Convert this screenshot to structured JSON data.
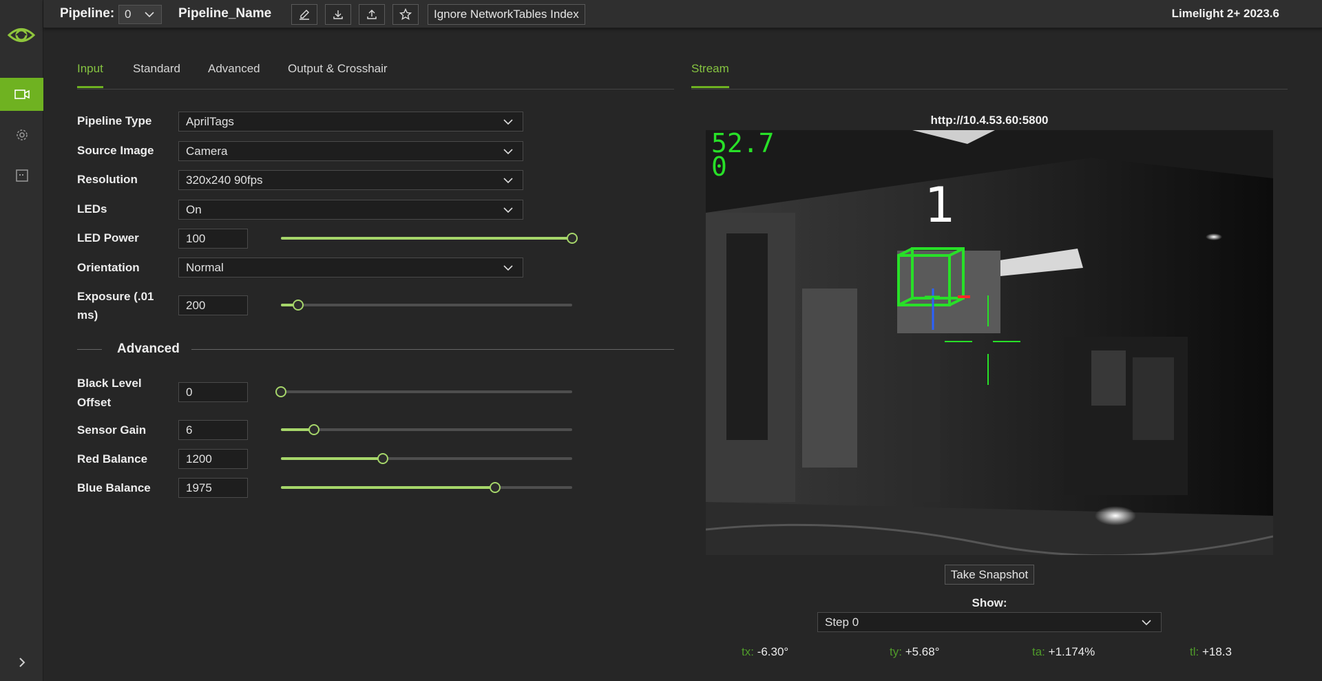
{
  "topbar": {
    "pipeline_label": "Pipeline:",
    "pipeline_value": "0",
    "pipeline_name": "Pipeline_Name",
    "ignore_label": "Ignore NetworkTables Index",
    "brand": "Limelight 2+ 2023.6"
  },
  "left_tabs": [
    {
      "label": "Input",
      "active": true
    },
    {
      "label": "Standard",
      "active": false
    },
    {
      "label": "Advanced",
      "active": false
    },
    {
      "label": "Output & Crosshair",
      "active": false
    }
  ],
  "right_tabs": [
    {
      "label": "Stream",
      "active": true
    }
  ],
  "form": {
    "pipeline_type": {
      "label": "Pipeline Type",
      "value": "AprilTags"
    },
    "source_image": {
      "label": "Source Image",
      "value": "Camera"
    },
    "resolution": {
      "label": "Resolution",
      "value": "320x240 90fps"
    },
    "leds": {
      "label": "LEDs",
      "value": "On"
    },
    "led_power": {
      "label": "LED Power",
      "value": "100",
      "slider_fraction": 1.0
    },
    "orientation": {
      "label": "Orientation",
      "value": "Normal"
    },
    "exposure": {
      "label_line1": "Exposure (.01",
      "label_line2": "ms)",
      "value": "200",
      "slider_fraction": 0.06
    }
  },
  "advanced": {
    "title": "Advanced",
    "black_level": {
      "label_line1": "Black Level",
      "label_line2": "Offset",
      "value": "0",
      "slider_fraction": 0.0
    },
    "sensor_gain": {
      "label": "Sensor Gain",
      "value": "6",
      "slider_fraction": 0.114
    },
    "red_balance": {
      "label": "Red Balance",
      "value": "1200",
      "slider_fraction": 0.35
    },
    "blue_balance": {
      "label": "Blue Balance",
      "value": "1975",
      "slider_fraction": 0.735
    }
  },
  "stream": {
    "url": "http://10.4.53.60:5800",
    "overlay_fps": "52.7",
    "overlay_line2": "0",
    "tag_id": "1",
    "snapshot_label": "Take Snapshot",
    "show_label": "Show:",
    "show_value": "Step 0",
    "stats": [
      {
        "key": "tx:",
        "value": "-6.30°"
      },
      {
        "key": "ty:",
        "value": "+5.68°"
      },
      {
        "key": "ta:",
        "value": "+1.174%"
      },
      {
        "key": "tl:",
        "value": "+18.3"
      }
    ]
  },
  "colors": {
    "accent": "#6fb221",
    "accent_light": "#a6d66a",
    "overlay_green": "#28e028"
  },
  "icons": {
    "logo": "limelight-logo-icon",
    "nav": [
      "camera-icon",
      "gear-icon",
      "grid-icon"
    ],
    "expand": "chevron-right-icon",
    "toolbar": [
      "pencil-icon",
      "download-icon",
      "upload-icon",
      "star-icon"
    ]
  }
}
